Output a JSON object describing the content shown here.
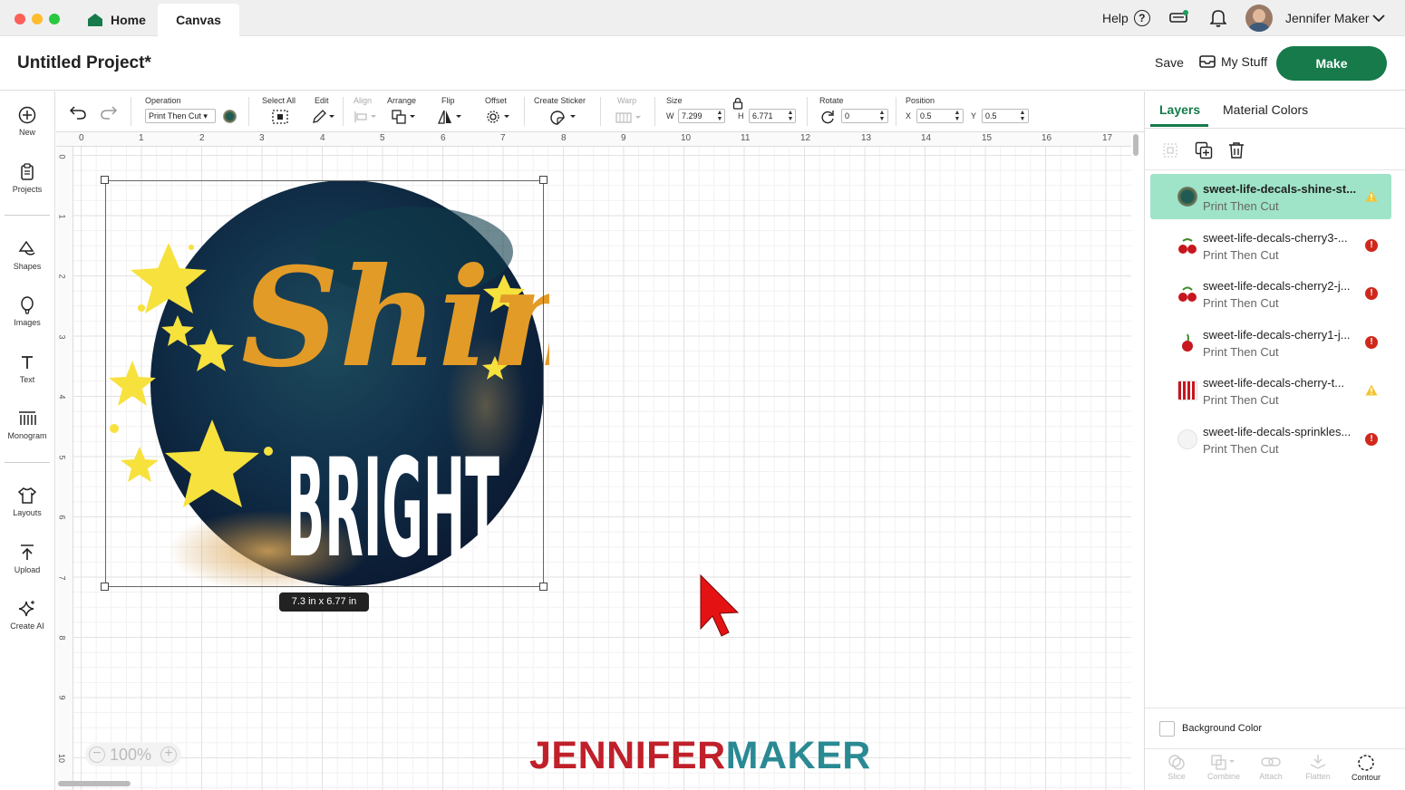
{
  "tabs": {
    "home": "Home",
    "canvas": "Canvas"
  },
  "topbar": {
    "help": "Help",
    "user_name": "Jennifer Maker"
  },
  "header": {
    "project_title": "Untitled Project*",
    "save": "Save",
    "my_stuff": "My Stuff",
    "make": "Make"
  },
  "leftrail": [
    "New",
    "Projects",
    "Shapes",
    "Images",
    "Text",
    "Monogram",
    "Layouts",
    "Upload",
    "Create AI"
  ],
  "toolbar": {
    "operation_label": "Operation",
    "operation_value": "Print Then Cut",
    "select_all": "Select All",
    "edit": "Edit",
    "align": "Align",
    "arrange": "Arrange",
    "flip": "Flip",
    "offset": "Offset",
    "create_sticker": "Create Sticker",
    "warp": "Warp",
    "size": "Size",
    "w_label": "W",
    "w_value": "7.299",
    "h_label": "H",
    "h_value": "6.771",
    "rotate": "Rotate",
    "rotate_value": "0",
    "position": "Position",
    "x_label": "X",
    "x_value": "0.5",
    "y_label": "Y",
    "y_value": "0.5"
  },
  "ruler": {
    "h": [
      "0",
      "1",
      "2",
      "3",
      "4",
      "5",
      "6",
      "7",
      "8",
      "9",
      "10",
      "11",
      "12",
      "13",
      "14",
      "15",
      "16",
      "17"
    ],
    "v": [
      "0",
      "1",
      "2",
      "3",
      "4",
      "5",
      "6",
      "7",
      "8",
      "9",
      "10"
    ]
  },
  "canvas": {
    "design_word1": "Shine",
    "design_word2": "BRIGHT",
    "size_badge": "7.3  in x 6.77  in",
    "zoom": "100%",
    "watermark_a": "JENNIFER",
    "watermark_b": "MAKER"
  },
  "panel": {
    "tab_layers": "Layers",
    "tab_material_colors": "Material Colors",
    "layers": [
      {
        "name": "sweet-life-decals-shine-st...",
        "sub": "Print Then Cut",
        "status": "warning",
        "selected": true
      },
      {
        "name": "sweet-life-decals-cherry3-...",
        "sub": "Print Then Cut",
        "status": "error",
        "selected": false
      },
      {
        "name": "sweet-life-decals-cherry2-j...",
        "sub": "Print Then Cut",
        "status": "error",
        "selected": false
      },
      {
        "name": "sweet-life-decals-cherry1-j...",
        "sub": "Print Then Cut",
        "status": "error",
        "selected": false
      },
      {
        "name": "sweet-life-decals-cherry-t...",
        "sub": "Print Then Cut",
        "status": "warning",
        "selected": false
      },
      {
        "name": "sweet-life-decals-sprinkles...",
        "sub": "Print Then Cut",
        "status": "error",
        "selected": false
      }
    ],
    "background_color": "Background Color",
    "bottom_tools": [
      "Slice",
      "Combine",
      "Attach",
      "Flatten",
      "Contour"
    ]
  },
  "colors": {
    "accent_green": "#167a4b",
    "selected_layer": "#9fe4c8",
    "brand_red": "#c0202a",
    "brand_teal": "#2a8a93",
    "star_yellow": "#f8e33c",
    "script_orange": "#e39b27"
  }
}
